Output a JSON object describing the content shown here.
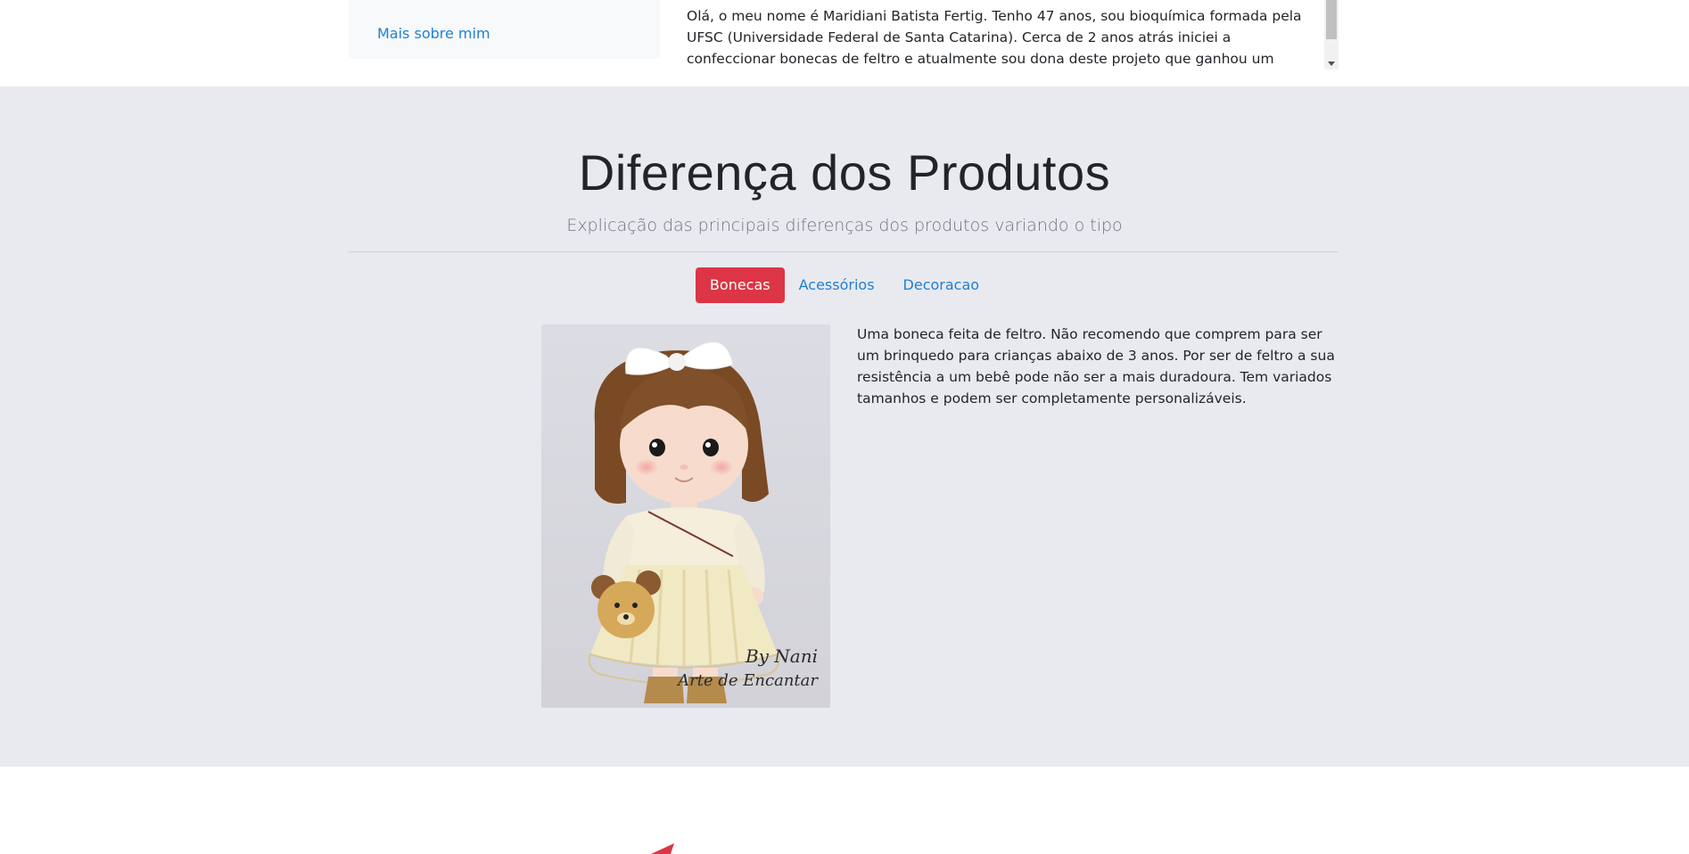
{
  "about": {
    "link_label": "Mais sobre mim",
    "text": "Olá, o meu nome é Maridiani Batista Fertig. Tenho 47 anos, sou bioquímica formada pela UFSC (Universidade Federal de Santa Catarina). Cerca de 2 anos atrás iniciei a confeccionar bonecas de feltro e atualmente sou dona deste projeto que ganhou um espaço muito importante no meu"
  },
  "products": {
    "title": "Diferença dos Produtos",
    "subtitle": "Explicação das principais diferenças dos produtos variando o tipo",
    "tabs": [
      {
        "label": "Bonecas"
      },
      {
        "label": "Acessórios"
      },
      {
        "label": "Decoracao"
      }
    ],
    "description": "Uma boneca feita de feltro. Não recomendo que comprem para ser um brinquedo para crianças abaixo de 3 anos. Por ser de feltro a sua resistência a um bebê pode não ser a mais duradoura. Tem variados tamanhos e podem ser completamente personalizáveis.",
    "image_watermark_line1": "By Nani",
    "image_watermark_line2": "Arte de Encantar"
  },
  "colors": {
    "accent": "#dc3545",
    "link": "#1e7fd6",
    "section_bg": "#e9eaf0"
  }
}
